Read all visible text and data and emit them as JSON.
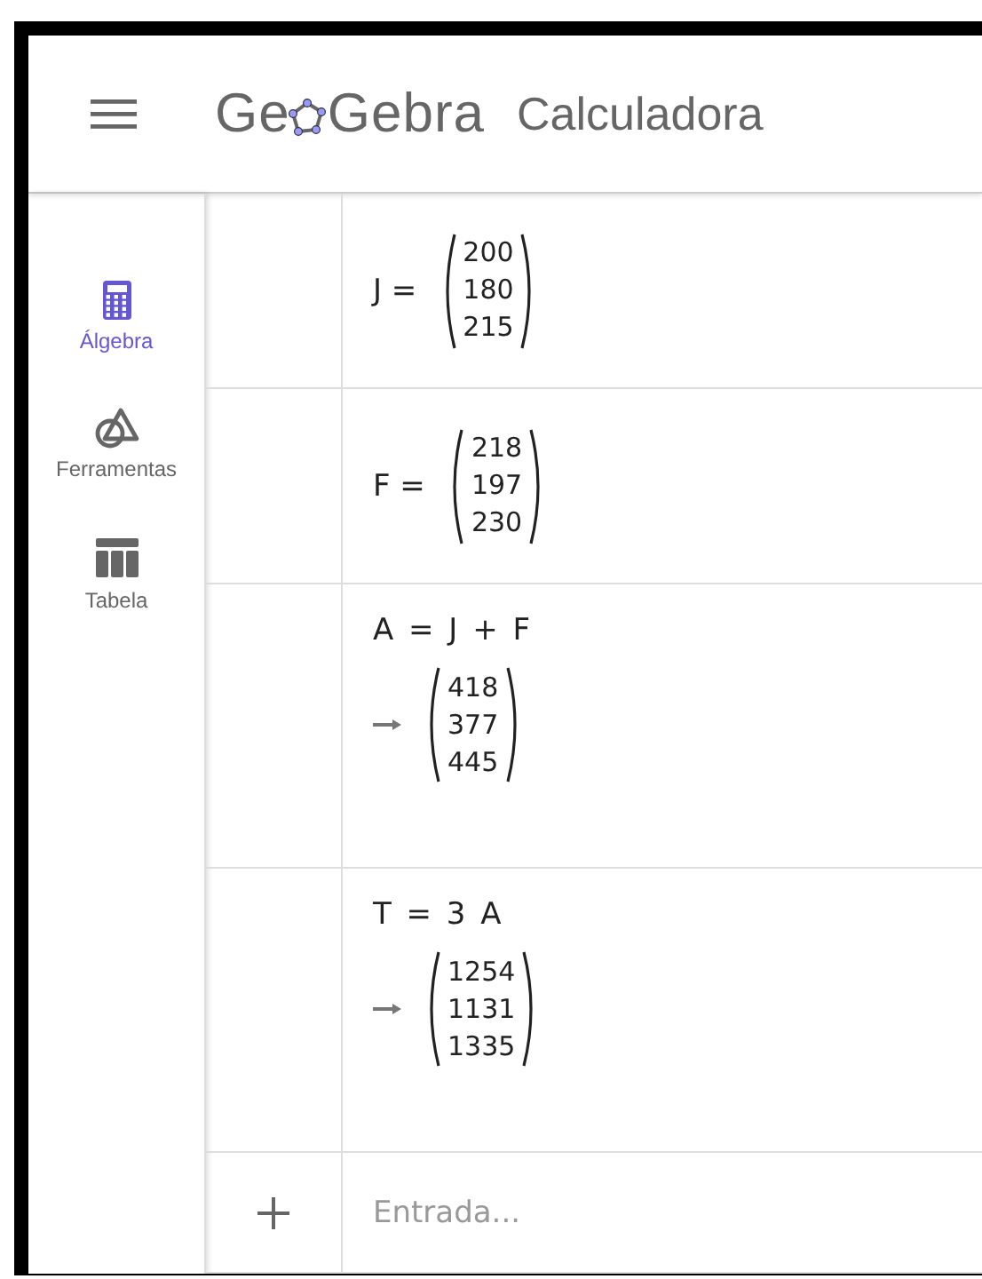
{
  "header": {
    "logo_parts": [
      "Ge",
      "Gebra"
    ],
    "app_title": "Calculadora"
  },
  "sidebar": {
    "items": [
      {
        "label": "Álgebra",
        "kind": "calculator",
        "selected": true
      },
      {
        "label": "Ferramentas",
        "kind": "tools",
        "selected": false
      },
      {
        "label": "Tabela",
        "kind": "table",
        "selected": false
      }
    ]
  },
  "algebra": {
    "rows": [
      {
        "kind": "definition",
        "lhs": "J =",
        "vector": [
          "200",
          "180",
          "215"
        ]
      },
      {
        "kind": "definition",
        "lhs": "F =",
        "vector": [
          "218",
          "197",
          "230"
        ]
      },
      {
        "kind": "computed",
        "formula": "A = J + F",
        "vector": [
          "418",
          "377",
          "445"
        ]
      },
      {
        "kind": "computed",
        "formula": "T = 3 A",
        "vector": [
          "1254",
          "1131",
          "1335"
        ]
      }
    ],
    "input": {
      "placeholder": "Entrada..."
    }
  }
}
